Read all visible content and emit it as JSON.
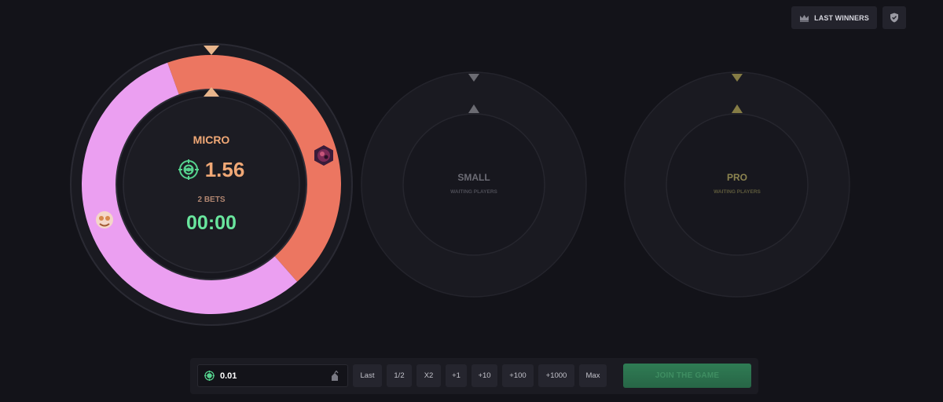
{
  "header": {
    "last_winners_label": "LAST WINNERS",
    "icons": {
      "crown": "crown-icon",
      "fair": "shield-check-icon"
    }
  },
  "rooms": [
    {
      "name": "MICRO",
      "pot": "1.56",
      "bets": "2 BETS",
      "timer": "00:00",
      "currency_icon": "target-coin-icon",
      "segments": [
        {
          "player": "player-1",
          "share": 0.44,
          "color": "#ec7661"
        },
        {
          "player": "player-2",
          "share": 0.56,
          "color": "#eb9ff1"
        }
      ],
      "accent": "#f0a876",
      "pointer_color": "#e8b58c"
    },
    {
      "name": "SMALL",
      "status": "WAITING PLAYERS",
      "accent": "#6c6c75",
      "pointer_color": "#6b6b72"
    },
    {
      "name": "PRO",
      "status": "WAITING PLAYERS",
      "accent": "#8c8450",
      "pointer_color": "#857c45"
    }
  ],
  "bet_bar": {
    "amount": "0.01",
    "chips": [
      "Last",
      "1/2",
      "X2",
      "+1",
      "+10",
      "+100",
      "+1000",
      "Max"
    ],
    "join_label": "JOIN THE GAME"
  },
  "colors": {
    "background": "#131319",
    "panel": "#1b1b22",
    "join_green": "#2f7c54"
  }
}
